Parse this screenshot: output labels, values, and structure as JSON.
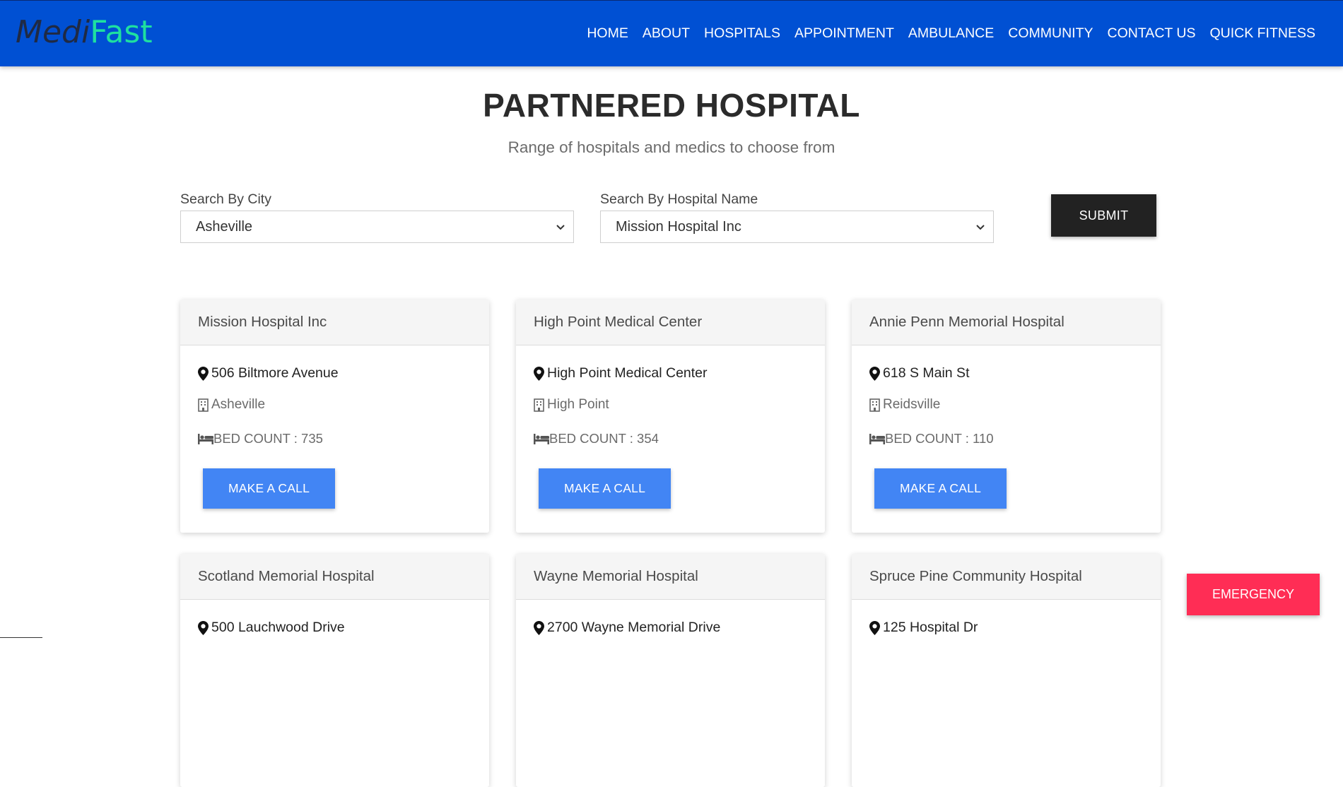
{
  "brand": {
    "part1": "Medi",
    "part2": "Fast"
  },
  "nav": {
    "items": [
      "HOME",
      "ABOUT",
      "HOSPITALS",
      "APPOINTMENT",
      "AMBULANCE",
      "COMMUNITY",
      "CONTACT US",
      "QUICK FITNESS"
    ]
  },
  "page": {
    "title": "PARTNERED HOSPITAL",
    "subtitle": "Range of hospitals and medics to choose from"
  },
  "search": {
    "city_label": "Search By City",
    "city_value": "Asheville",
    "hospital_label": "Search By Hospital Name",
    "hospital_value": "Mission Hospital Inc",
    "submit_label": "SUBMIT"
  },
  "hospitals": [
    {
      "name": "Mission Hospital Inc",
      "address": "506 Biltmore Avenue",
      "city": "Asheville",
      "beds": "BED COUNT : 735",
      "call_label": "MAKE A CALL"
    },
    {
      "name": "High Point Medical Center",
      "address": "High Point Medical Center",
      "city": "High Point",
      "beds": "BED COUNT : 354",
      "call_label": "MAKE A CALL"
    },
    {
      "name": "Annie Penn Memorial Hospital",
      "address": "618 S Main St",
      "city": "Reidsville",
      "beds": "BED COUNT : 110",
      "call_label": "MAKE A CALL"
    },
    {
      "name": "Scotland Memorial Hospital",
      "address": "500 Lauchwood Drive"
    },
    {
      "name": "Wayne Memorial Hospital",
      "address": "2700 Wayne Memorial Drive"
    },
    {
      "name": "Spruce Pine Community Hospital",
      "address": "125 Hospital Dr"
    }
  ],
  "emergency_label": "EMERGENCY",
  "icons": {
    "address": "map-pin-icon",
    "city": "building-icon",
    "beds": "bed-icon",
    "dropdown": "chevron-down-icon"
  },
  "colors": {
    "nav_bg": "#0050d3",
    "brand_accent": "#1ee0a0",
    "call_button": "#4285f4",
    "submit_button": "#222222",
    "emergency": "#ff2d55"
  }
}
